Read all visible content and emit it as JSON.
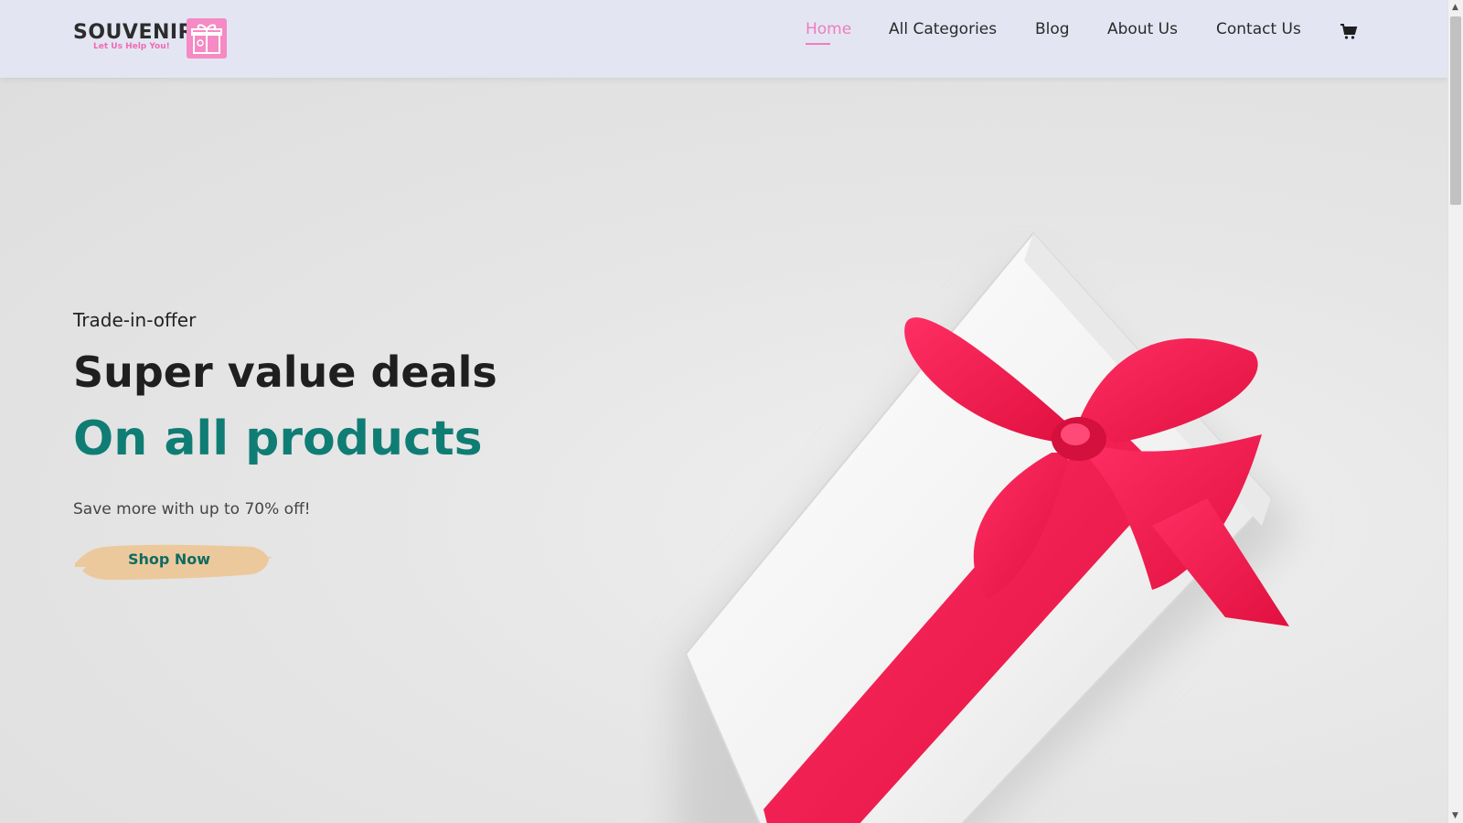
{
  "brand": {
    "name": "SOUVENIR",
    "tagline": "Let Us Help You!",
    "accent_color": "#f07cc0",
    "logo_box_color": "#f58ac4"
  },
  "nav": {
    "items": [
      {
        "label": "Home",
        "active": true
      },
      {
        "label": "All Categories",
        "active": false
      },
      {
        "label": "Blog",
        "active": false
      },
      {
        "label": "About Us",
        "active": false
      },
      {
        "label": "Contact Us",
        "active": false
      }
    ],
    "cart_icon": "shopping-cart-icon"
  },
  "hero": {
    "eyebrow": "Trade-in-offer",
    "headline": "Super value deals",
    "headline_highlight": "On all products",
    "highlight_color": "#0f7d74",
    "subtext": "Save more with up to 70% off!",
    "cta_label": "Shop Now",
    "cta_color": "#ecc99c",
    "image": "gift-box-with-red-ribbon"
  }
}
